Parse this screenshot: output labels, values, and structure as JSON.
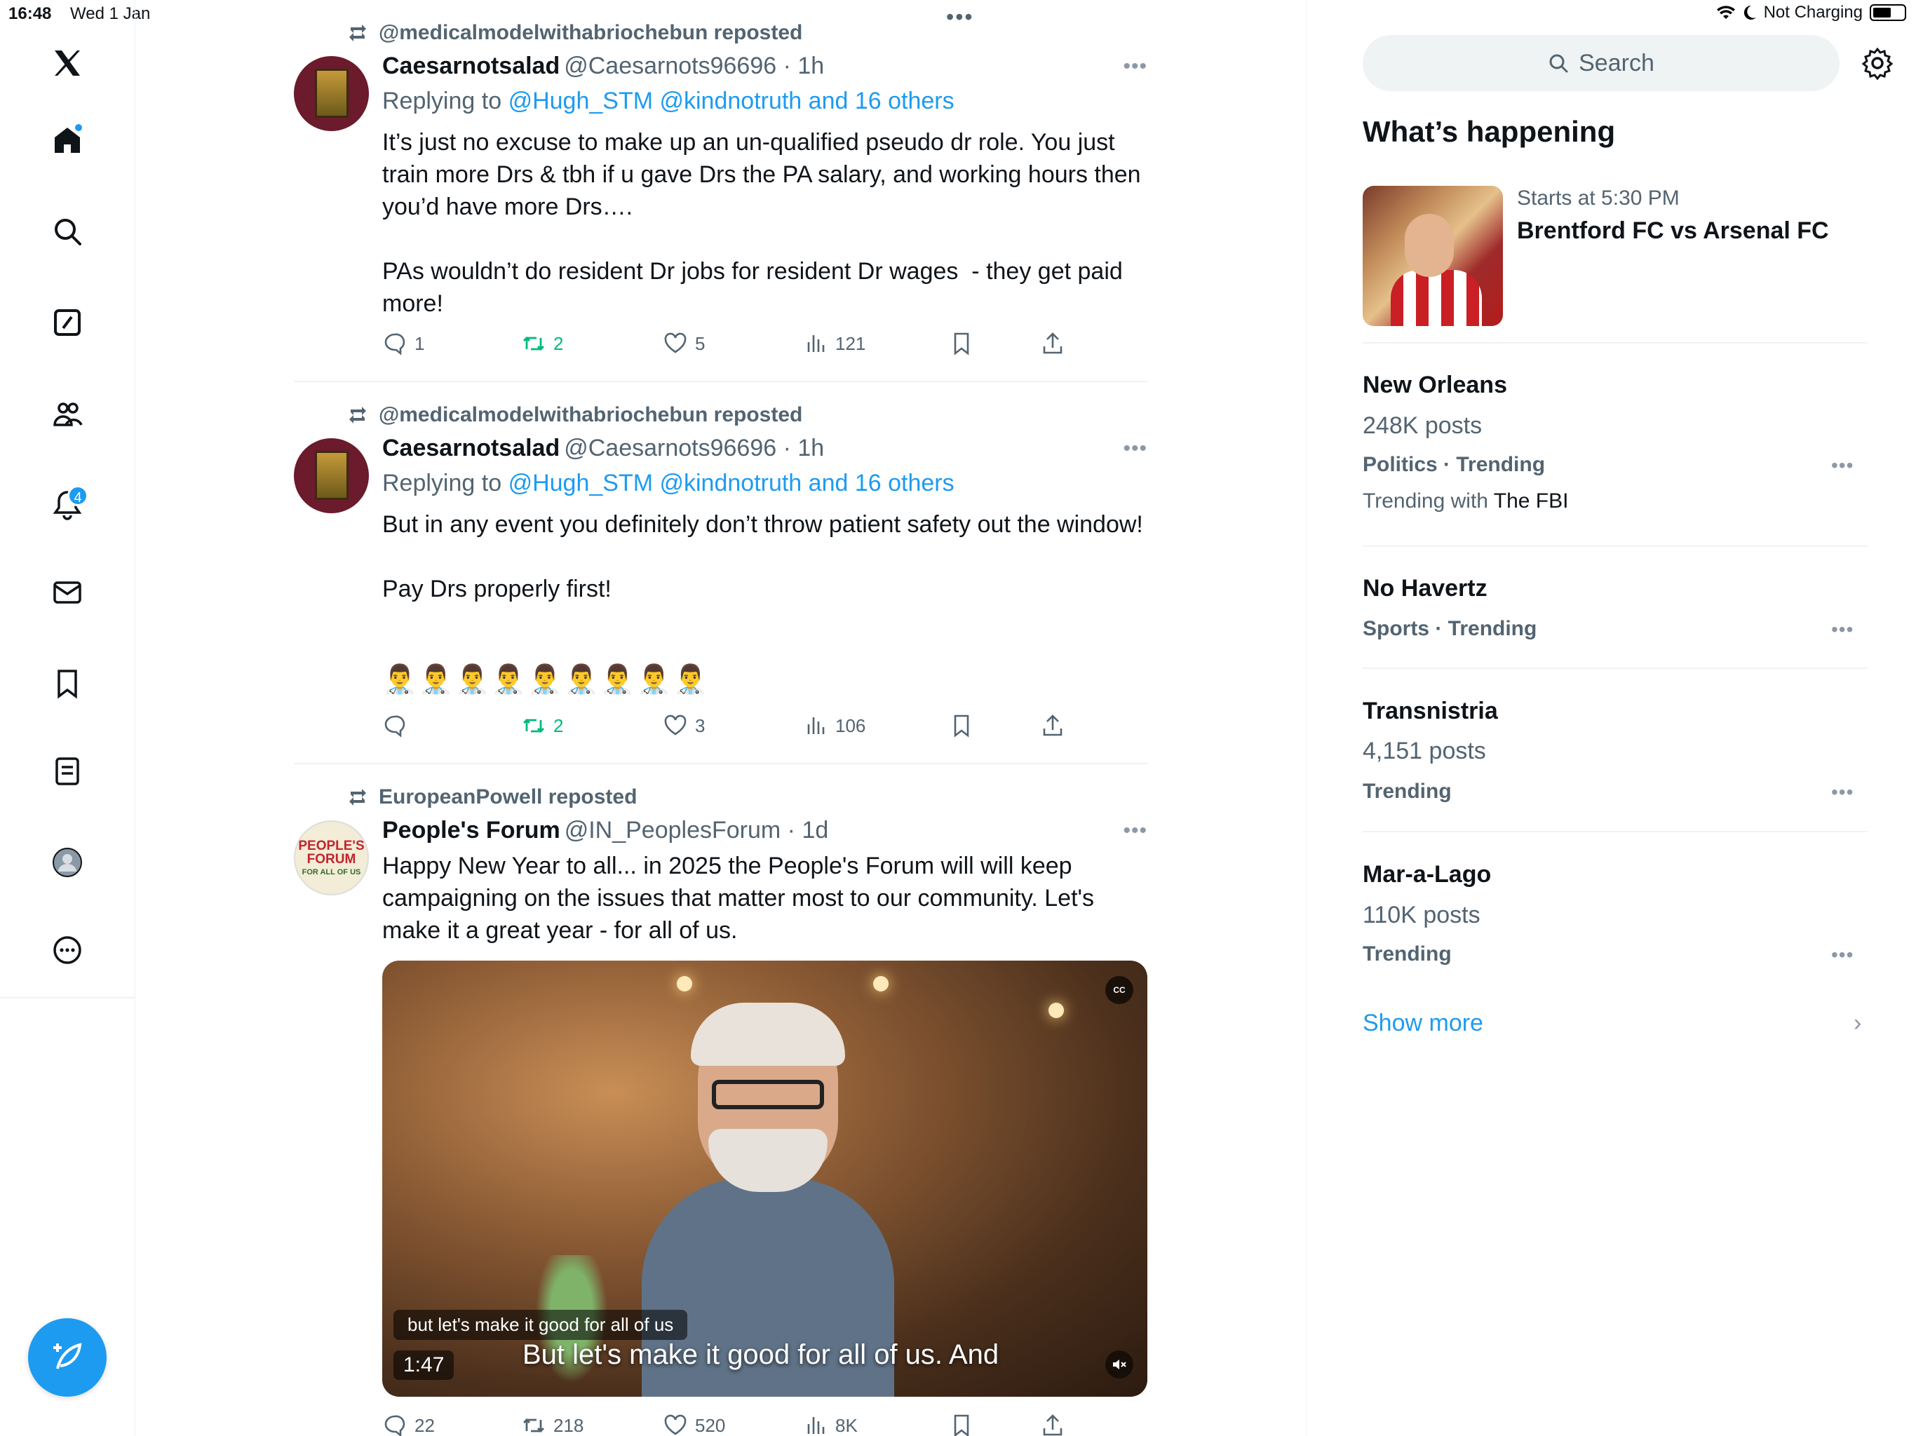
{
  "status_bar": {
    "time": "16:48",
    "date": "Wed 1 Jan",
    "charging": "Not Charging"
  },
  "nav": {
    "notifications_badge": "4",
    "items": [
      "x-logo-icon",
      "home-icon",
      "search-icon",
      "grok-icon",
      "communities-icon",
      "notifications-icon",
      "messages-icon",
      "bookmarks-icon",
      "lists-icon",
      "profile-icon",
      "more-icon"
    ],
    "compose_icon": "compose-post-icon"
  },
  "feed": {
    "top_dots": "•••",
    "tweets": [
      {
        "reposted_by": "@medicalmodelwithabriochebun reposted",
        "name": "Caesarnotsalad",
        "handle": "@Caesarnots96696 · 1h",
        "replying_prefix": "Replying to",
        "replying_mentions": "@Hugh_STM @kindnotruth and 16 others",
        "text": "It’s just no excuse to make up an un-qualified pseudo dr role. You just train more Drs & tbh if u gave Drs the PA salary, and working hours then you’d have more Drs….\n\nPAs wouldn’t do resident Dr jobs for resident Dr wages  - they get paid more!",
        "replies": "1",
        "reposts": "2",
        "likes": "5",
        "views": "121"
      },
      {
        "reposted_by": "@medicalmodelwithabriochebun reposted",
        "name": "Caesarnotsalad",
        "handle": "@Caesarnots96696 · 1h",
        "replying_prefix": "Replying to",
        "replying_mentions": "@Hugh_STM @kindnotruth and 16 others",
        "text": "But in any event you definitely don’t throw patient safety out the window!\n\nPay Drs properly first!",
        "emojis": "👨‍⚕️👨‍⚕️👨‍⚕️👨‍⚕️👨‍⚕️👨‍⚕️👨‍⚕️👨‍⚕️👨‍⚕️",
        "replies": "",
        "reposts": "2",
        "likes": "3",
        "views": "106"
      },
      {
        "reposted_by": "EuropeanPowell reposted",
        "name": "People's Forum",
        "handle": "@IN_PeoplesForum · 1d",
        "avatar_text": "PEOPLE'S FORUM",
        "avatar_subtext": "FOR ALL OF US",
        "text": "Happy New Year to all... in 2025 the People's Forum will will keep campaigning on the issues that matter most to our community. Let's make it a great year - for all of us.",
        "video": {
          "caption_small": "but let's make it good for all of us",
          "caption_big": "But let's make it good for all of us. And",
          "duration": "1:47",
          "cc_label": "CC"
        },
        "replies": "22",
        "reposts": "218",
        "likes": "520",
        "views": "8K"
      }
    ]
  },
  "sidebar": {
    "search_placeholder": "Search",
    "title": "What’s happening",
    "event": {
      "subtitle": "Starts at 5:30 PM",
      "title": "Brentford FC vs Arsenal FC"
    },
    "trends": [
      {
        "title": "New Orleans",
        "posts": "248K posts",
        "category": "Politics · Trending",
        "with_prefix": "Trending with",
        "with_topic": "The FBI"
      },
      {
        "title": "No Havertz",
        "category": "Sports · Trending"
      },
      {
        "title": "Transnistria",
        "posts": "4,151 posts",
        "category": "Trending"
      },
      {
        "title": "Mar-a-Lago",
        "posts": "110K posts",
        "category": "Trending"
      }
    ],
    "show_more": "Show more"
  },
  "colors": {
    "accent": "#1d9bf0",
    "repost_green": "#00ba7c",
    "muted": "#536471"
  }
}
